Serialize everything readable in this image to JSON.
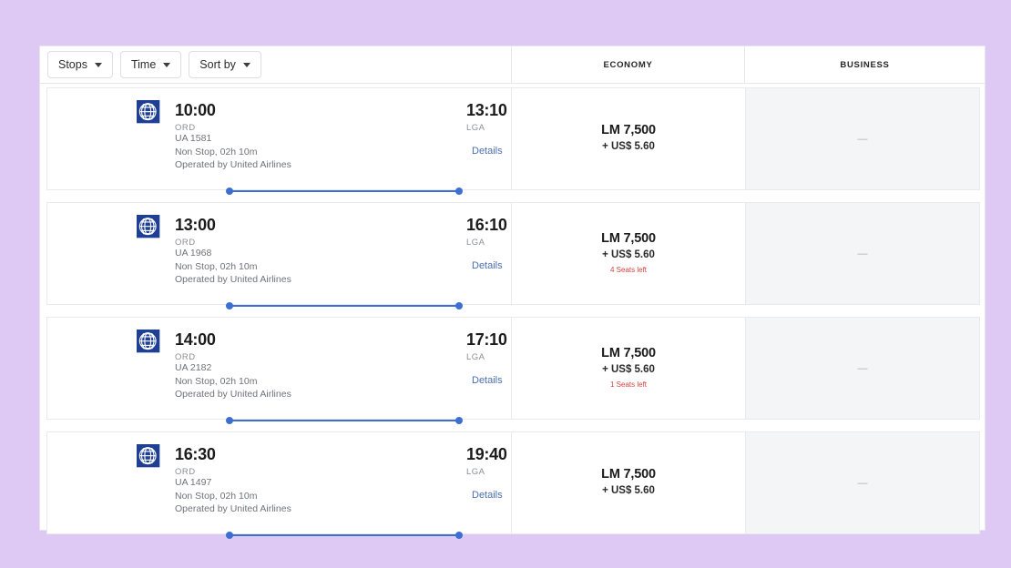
{
  "toolbar": {
    "filters": [
      {
        "label": "Stops",
        "icon": "chevron-down-icon"
      },
      {
        "label": "Time",
        "icon": "chevron-down-icon"
      },
      {
        "label": "Sort by",
        "icon": "chevron-down-icon"
      }
    ],
    "columns": [
      {
        "label": "ECONOMY"
      },
      {
        "label": "BUSINESS"
      }
    ]
  },
  "colors": {
    "page_background": "#dec9f5",
    "route_accent": "#3c6fd1",
    "details_link": "#4a6fb5",
    "seats_warning": "#d4413f",
    "business_cell": "#f4f5f7",
    "logo_blue": "#1f3f94"
  },
  "details_label": "Details",
  "empty_fare": "—",
  "flights": [
    {
      "airline_logo": "united-airlines-logo",
      "depart_time": "10:00",
      "depart_airport": "ORD",
      "arrive_time": "13:10",
      "arrive_airport": "LGA",
      "flight_number": "UA 1581",
      "stops_duration": "Non Stop, 02h 10m",
      "operated_by": "Operated by United Airlines",
      "economy": {
        "price": "LM 7,500",
        "tax": "+ US$ 5.60",
        "seats_left": ""
      },
      "business": {
        "price": "—"
      }
    },
    {
      "airline_logo": "united-airlines-logo",
      "depart_time": "13:00",
      "depart_airport": "ORD",
      "arrive_time": "16:10",
      "arrive_airport": "LGA",
      "flight_number": "UA 1968",
      "stops_duration": "Non Stop, 02h 10m",
      "operated_by": "Operated by United Airlines",
      "economy": {
        "price": "LM 7,500",
        "tax": "+ US$ 5.60",
        "seats_left": "4 Seats left"
      },
      "business": {
        "price": "—"
      }
    },
    {
      "airline_logo": "united-airlines-logo",
      "depart_time": "14:00",
      "depart_airport": "ORD",
      "arrive_time": "17:10",
      "arrive_airport": "LGA",
      "flight_number": "UA 2182",
      "stops_duration": "Non Stop, 02h 10m",
      "operated_by": "Operated by United Airlines",
      "economy": {
        "price": "LM 7,500",
        "tax": "+ US$ 5.60",
        "seats_left": "1 Seats left"
      },
      "business": {
        "price": "—"
      }
    },
    {
      "airline_logo": "united-airlines-logo",
      "depart_time": "16:30",
      "depart_airport": "ORD",
      "arrive_time": "19:40",
      "arrive_airport": "LGA",
      "flight_number": "UA 1497",
      "stops_duration": "Non Stop, 02h 10m",
      "operated_by": "Operated by United Airlines",
      "economy": {
        "price": "LM 7,500",
        "tax": "+ US$ 5.60",
        "seats_left": ""
      },
      "business": {
        "price": "—"
      }
    }
  ]
}
